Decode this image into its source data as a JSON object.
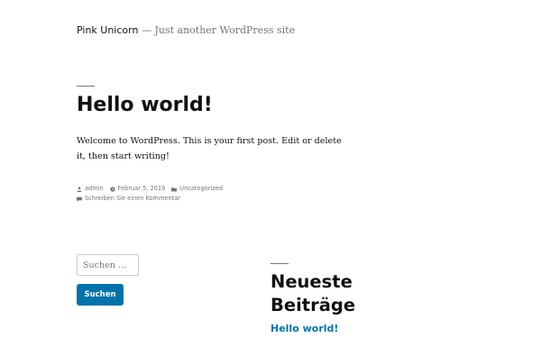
{
  "site": {
    "title": "Pink Unicorn",
    "separator": "—",
    "description": "Just another WordPress site"
  },
  "post": {
    "title": "Hello world!",
    "content": "Welcome to WordPress. This is your first post. Edit or delete it, then start writing!",
    "meta": {
      "author_icon": "person-icon",
      "author": "admin",
      "date_icon": "clock-icon",
      "date": "Februar 5, 2019",
      "category_icon": "folder-icon",
      "category": "Uncategorized",
      "comment_icon": "comment-icon",
      "comment_link": "Schreiben Sie einen Kommentar"
    }
  },
  "search": {
    "placeholder": "Suchen …",
    "button_label": "Suchen"
  },
  "recent_posts": {
    "title": "Neueste Beiträge",
    "items": [
      "Hello world!"
    ]
  },
  "colors": {
    "accent": "#0073aa",
    "text": "#111111",
    "muted": "#767676"
  }
}
